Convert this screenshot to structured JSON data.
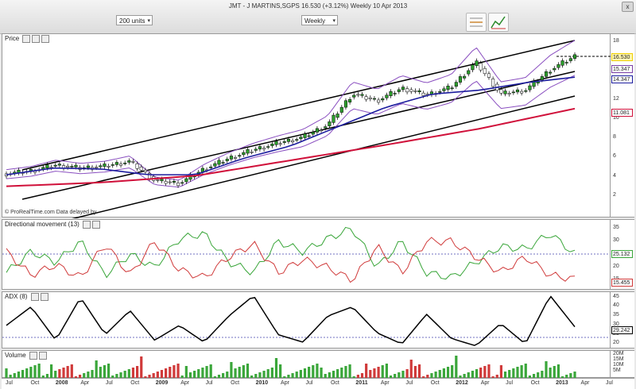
{
  "window": {
    "title": "JMT - J MARTINS,SGPS    16.530 (+3.12%)    Weekly  10 Apr 2013",
    "close_label": "x"
  },
  "toolbar": {
    "range_select": "200 units",
    "period_select": "Weekly",
    "icons": [
      "horizontal-line-icon",
      "chart-style-icon"
    ]
  },
  "price_panel": {
    "title": "Price",
    "credit": "© ProRealTime.com  Data delayed by",
    "ticks": [
      "18",
      "16",
      "14",
      "12",
      "10",
      "8",
      "6",
      "4",
      "2"
    ],
    "value_boxes": [
      {
        "label": "16.530",
        "color": "#f0d000"
      },
      {
        "label": "15.347",
        "color": "#7a3fa6"
      },
      {
        "label": "14.347",
        "color": "#1c1c9e"
      },
      {
        "label": "11.081",
        "color": "#d0103a"
      }
    ]
  },
  "dm_panel": {
    "title": "Directional movement (13)",
    "ticks": [
      "35",
      "30",
      "25",
      "20",
      "15"
    ],
    "value_boxes": [
      {
        "label": "25.132",
        "color": "#3aa63a"
      },
      {
        "label": "15.455",
        "color": "#d03a3a"
      }
    ]
  },
  "adx_panel": {
    "title": "ADX (8)",
    "ticks": [
      "45",
      "40",
      "35",
      "30",
      "25",
      "20"
    ],
    "value_boxes": [
      {
        "label": "29.242",
        "color": "#000000"
      }
    ]
  },
  "volume_panel": {
    "title": "Volume",
    "ticks": [
      "20M",
      "15M",
      "10M",
      "5M"
    ]
  },
  "x_axis": [
    {
      "label": "Jul",
      "year": false
    },
    {
      "label": "Oct",
      "year": false
    },
    {
      "label": "2008",
      "year": true
    },
    {
      "label": "Apr",
      "year": false
    },
    {
      "label": "Jul",
      "year": false
    },
    {
      "label": "Oct",
      "year": false
    },
    {
      "label": "2009",
      "year": true
    },
    {
      "label": "Apr",
      "year": false
    },
    {
      "label": "Jul",
      "year": false
    },
    {
      "label": "Oct",
      "year": false
    },
    {
      "label": "2010",
      "year": true
    },
    {
      "label": "Apr",
      "year": false
    },
    {
      "label": "Jul",
      "year": false
    },
    {
      "label": "Oct",
      "year": false
    },
    {
      "label": "2011",
      "year": true
    },
    {
      "label": "Apr",
      "year": false
    },
    {
      "label": "Jul",
      "year": false
    },
    {
      "label": "Oct",
      "year": false
    },
    {
      "label": "2012",
      "year": true
    },
    {
      "label": "Apr",
      "year": false
    },
    {
      "label": "Jul",
      "year": false
    },
    {
      "label": "Oct",
      "year": false
    },
    {
      "label": "2013",
      "year": true
    },
    {
      "label": "Apr",
      "year": false
    },
    {
      "label": "Jul",
      "year": false
    }
  ],
  "chart_data": {
    "type": "line",
    "title": "JMT - J MARTINS,SGPS",
    "timeframe": "Weekly",
    "price_series": [
      {
        "name": "close",
        "x": [
          "2007-07",
          "2007-10",
          "2008-01",
          "2008-04",
          "2008-07",
          "2008-10",
          "2009-01",
          "2009-04",
          "2009-07",
          "2009-10",
          "2010-01",
          "2010-04",
          "2010-07",
          "2010-10",
          "2011-01",
          "2011-04",
          "2011-07",
          "2011-10",
          "2012-01",
          "2012-04",
          "2012-07",
          "2012-10",
          "2013-01",
          "2013-04"
        ],
        "values": [
          4.3,
          4.6,
          5.2,
          4.9,
          5.1,
          5.6,
          3.6,
          3.3,
          4.8,
          5.9,
          6.8,
          7.5,
          8.1,
          9.4,
          12.6,
          11.9,
          13.2,
          12.5,
          13.3,
          15.9,
          12.6,
          13.0,
          15.1,
          16.53
        ]
      },
      {
        "name": "moving average (blue)",
        "x": [
          "2007-07",
          "2008-01",
          "2008-07",
          "2009-01",
          "2009-07",
          "2010-01",
          "2010-07",
          "2011-01",
          "2011-07",
          "2012-01",
          "2012-07",
          "2013-01",
          "2013-04"
        ],
        "values": [
          4.2,
          4.9,
          4.8,
          4.2,
          4.2,
          5.9,
          7.2,
          9.2,
          11.2,
          12.6,
          13.0,
          13.8,
          14.35
        ]
      },
      {
        "name": "moving average (red)",
        "x": [
          "2007-07",
          "2008-07",
          "2009-07",
          "2010-07",
          "2011-07",
          "2012-07",
          "2013-04"
        ],
        "values": [
          3.0,
          3.4,
          4.1,
          5.7,
          7.3,
          9.0,
          11.08
        ]
      }
    ],
    "dm_series": [
      {
        "name": "DI+",
        "values": [
          18,
          26,
          22,
          30,
          17,
          25,
          20,
          31,
          33,
          22,
          18,
          30,
          26,
          31,
          35,
          20,
          30,
          18,
          16,
          22,
          28,
          27,
          33,
          25.13
        ]
      },
      {
        "name": "DI-",
        "values": [
          26,
          17,
          21,
          16,
          29,
          17,
          30,
          19,
          16,
          24,
          29,
          18,
          23,
          20,
          15,
          28,
          18,
          30,
          30,
          24,
          18,
          24,
          17,
          15.46
        ]
      }
    ],
    "adx_values": [
      30,
      40,
      22,
      45,
      25,
      38,
      22,
      30,
      21,
      35,
      46,
      25,
      21,
      35,
      40,
      26,
      20,
      36,
      23,
      19,
      31,
      20,
      46,
      29.24
    ],
    "ylim_price": [
      0,
      18
    ],
    "ylim_dm": [
      12,
      37
    ],
    "ylim_adx": [
      18,
      47
    ],
    "grid": false
  }
}
